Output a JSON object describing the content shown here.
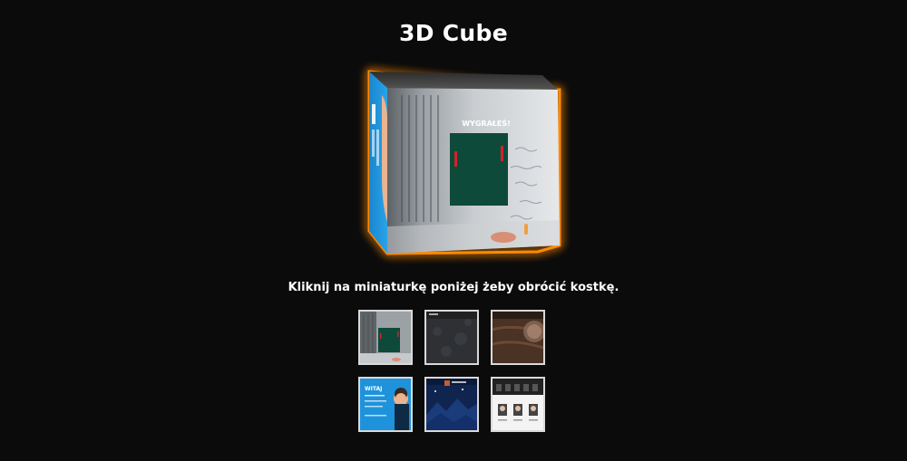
{
  "header": {
    "title": "3D Cube"
  },
  "cube": {
    "front_face_heading": "WYGRAŁEŚ!",
    "side_face_lines": [
      "WITAJ",
      "JESTEM",
      "WEBDEVELOPEREM"
    ],
    "glow_color": "#ff8a00",
    "side_face_color": "#1f8fd6",
    "board_color": "#0d4a3a",
    "paddle_color": "#d3232a"
  },
  "instructions": {
    "caption": "Kliknij na miniaturkę poniżej żeby obrócić kostkę."
  },
  "thumbnails": [
    {
      "name": "pong-game"
    },
    {
      "name": "dark-stone"
    },
    {
      "name": "wooden-surface"
    },
    {
      "name": "portfolio-welcome",
      "heading": "WITAJ"
    },
    {
      "name": "night-landscape"
    },
    {
      "name": "gallery-page"
    }
  ]
}
